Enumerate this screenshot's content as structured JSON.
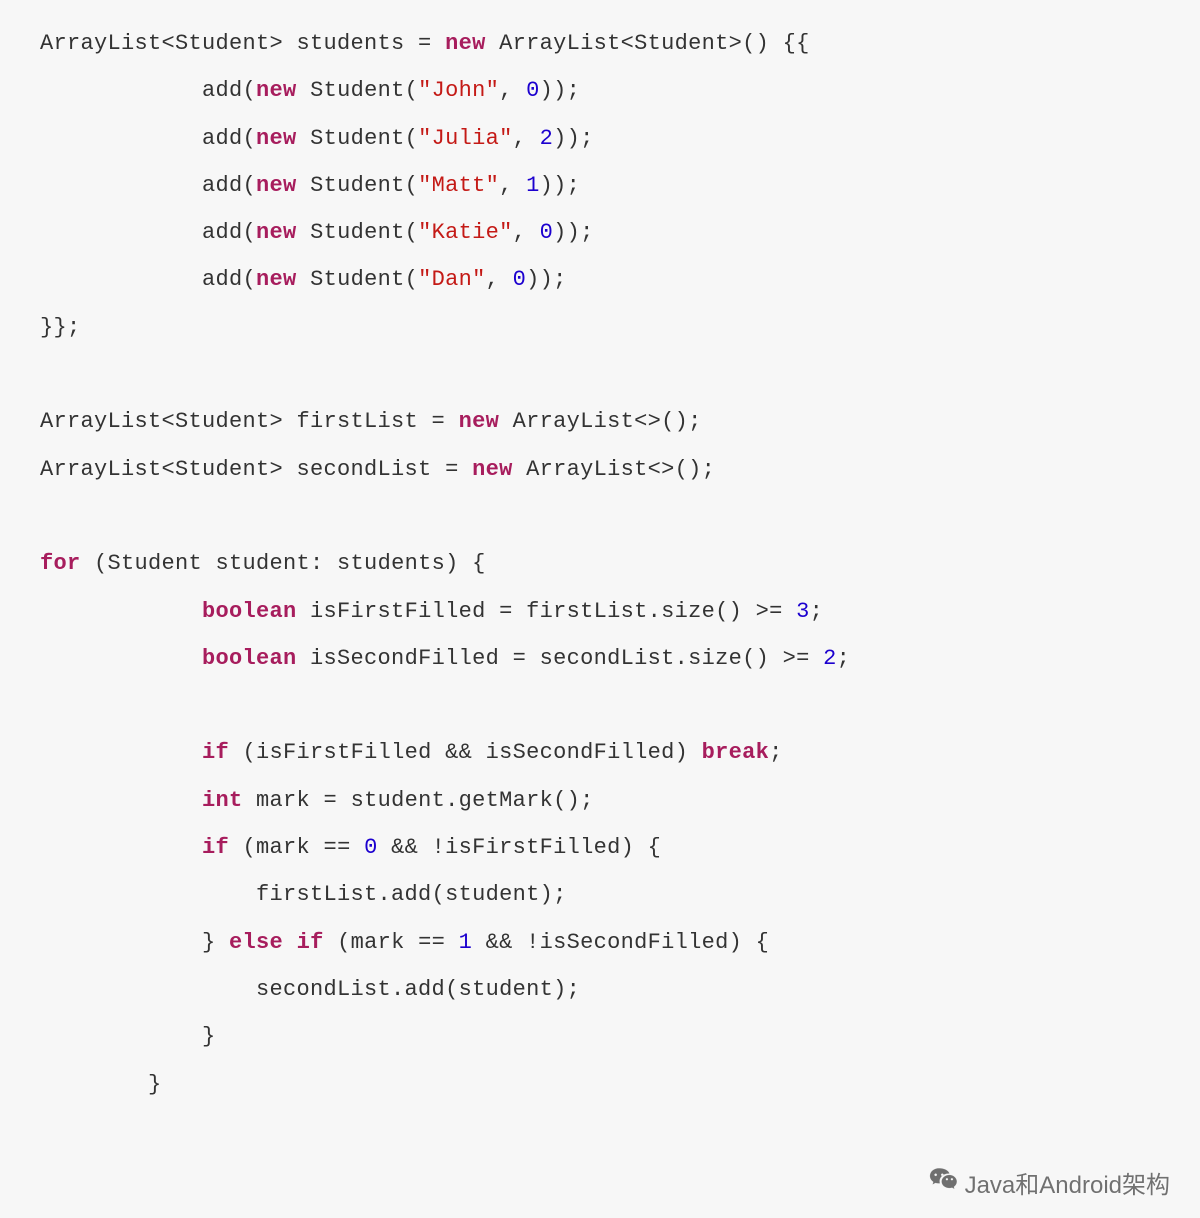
{
  "code": {
    "tokens": [
      [
        {
          "c": "pln",
          "t": "ArrayList<Student> students = "
        },
        {
          "c": "kw",
          "t": "new"
        },
        {
          "c": "pln",
          "t": " ArrayList<Student>() {{"
        }
      ],
      [
        {
          "c": "pln",
          "t": "            add("
        },
        {
          "c": "kw",
          "t": "new"
        },
        {
          "c": "pln",
          "t": " Student("
        },
        {
          "c": "str",
          "t": "\"John\""
        },
        {
          "c": "pln",
          "t": ", "
        },
        {
          "c": "num",
          "t": "0"
        },
        {
          "c": "pln",
          "t": "));"
        }
      ],
      [
        {
          "c": "pln",
          "t": "            add("
        },
        {
          "c": "kw",
          "t": "new"
        },
        {
          "c": "pln",
          "t": " Student("
        },
        {
          "c": "str",
          "t": "\"Julia\""
        },
        {
          "c": "pln",
          "t": ", "
        },
        {
          "c": "num",
          "t": "2"
        },
        {
          "c": "pln",
          "t": "));"
        }
      ],
      [
        {
          "c": "pln",
          "t": "            add("
        },
        {
          "c": "kw",
          "t": "new"
        },
        {
          "c": "pln",
          "t": " Student("
        },
        {
          "c": "str",
          "t": "\"Matt\""
        },
        {
          "c": "pln",
          "t": ", "
        },
        {
          "c": "num",
          "t": "1"
        },
        {
          "c": "pln",
          "t": "));"
        }
      ],
      [
        {
          "c": "pln",
          "t": "            add("
        },
        {
          "c": "kw",
          "t": "new"
        },
        {
          "c": "pln",
          "t": " Student("
        },
        {
          "c": "str",
          "t": "\"Katie\""
        },
        {
          "c": "pln",
          "t": ", "
        },
        {
          "c": "num",
          "t": "0"
        },
        {
          "c": "pln",
          "t": "));"
        }
      ],
      [
        {
          "c": "pln",
          "t": "            add("
        },
        {
          "c": "kw",
          "t": "new"
        },
        {
          "c": "pln",
          "t": " Student("
        },
        {
          "c": "str",
          "t": "\"Dan\""
        },
        {
          "c": "pln",
          "t": ", "
        },
        {
          "c": "num",
          "t": "0"
        },
        {
          "c": "pln",
          "t": "));"
        }
      ],
      [
        {
          "c": "pln",
          "t": "}};"
        }
      ],
      [],
      [
        {
          "c": "pln",
          "t": "ArrayList<Student> firstList = "
        },
        {
          "c": "kw",
          "t": "new"
        },
        {
          "c": "pln",
          "t": " ArrayList<>();"
        }
      ],
      [
        {
          "c": "pln",
          "t": "ArrayList<Student> secondList = "
        },
        {
          "c": "kw",
          "t": "new"
        },
        {
          "c": "pln",
          "t": " ArrayList<>();"
        }
      ],
      [],
      [
        {
          "c": "kw",
          "t": "for"
        },
        {
          "c": "pln",
          "t": " (Student student: students) {"
        }
      ],
      [
        {
          "c": "pln",
          "t": "            "
        },
        {
          "c": "kw",
          "t": "boolean"
        },
        {
          "c": "pln",
          "t": " isFirstFilled = firstList.size() >= "
        },
        {
          "c": "num",
          "t": "3"
        },
        {
          "c": "pln",
          "t": ";"
        }
      ],
      [
        {
          "c": "pln",
          "t": "            "
        },
        {
          "c": "kw",
          "t": "boolean"
        },
        {
          "c": "pln",
          "t": " isSecondFilled = secondList.size() >= "
        },
        {
          "c": "num",
          "t": "2"
        },
        {
          "c": "pln",
          "t": ";"
        }
      ],
      [],
      [
        {
          "c": "pln",
          "t": "            "
        },
        {
          "c": "kw",
          "t": "if"
        },
        {
          "c": "pln",
          "t": " (isFirstFilled && isSecondFilled) "
        },
        {
          "c": "kw",
          "t": "break"
        },
        {
          "c": "pln",
          "t": ";"
        }
      ],
      [
        {
          "c": "pln",
          "t": "            "
        },
        {
          "c": "kw",
          "t": "int"
        },
        {
          "c": "pln",
          "t": " mark = student.getMark();"
        }
      ],
      [
        {
          "c": "pln",
          "t": "            "
        },
        {
          "c": "kw",
          "t": "if"
        },
        {
          "c": "pln",
          "t": " (mark == "
        },
        {
          "c": "num",
          "t": "0"
        },
        {
          "c": "pln",
          "t": " && !isFirstFilled) {"
        }
      ],
      [
        {
          "c": "pln",
          "t": "                firstList.add(student);"
        }
      ],
      [
        {
          "c": "pln",
          "t": "            } "
        },
        {
          "c": "kw",
          "t": "else"
        },
        {
          "c": "pln",
          "t": " "
        },
        {
          "c": "kw",
          "t": "if"
        },
        {
          "c": "pln",
          "t": " (mark == "
        },
        {
          "c": "num",
          "t": "1"
        },
        {
          "c": "pln",
          "t": " && !isSecondFilled) {"
        }
      ],
      [
        {
          "c": "pln",
          "t": "                secondList.add(student);"
        }
      ],
      [
        {
          "c": "pln",
          "t": "            }"
        }
      ],
      [
        {
          "c": "pln",
          "t": "        }"
        }
      ]
    ]
  },
  "watermark": {
    "text": "Java和Android架构"
  }
}
